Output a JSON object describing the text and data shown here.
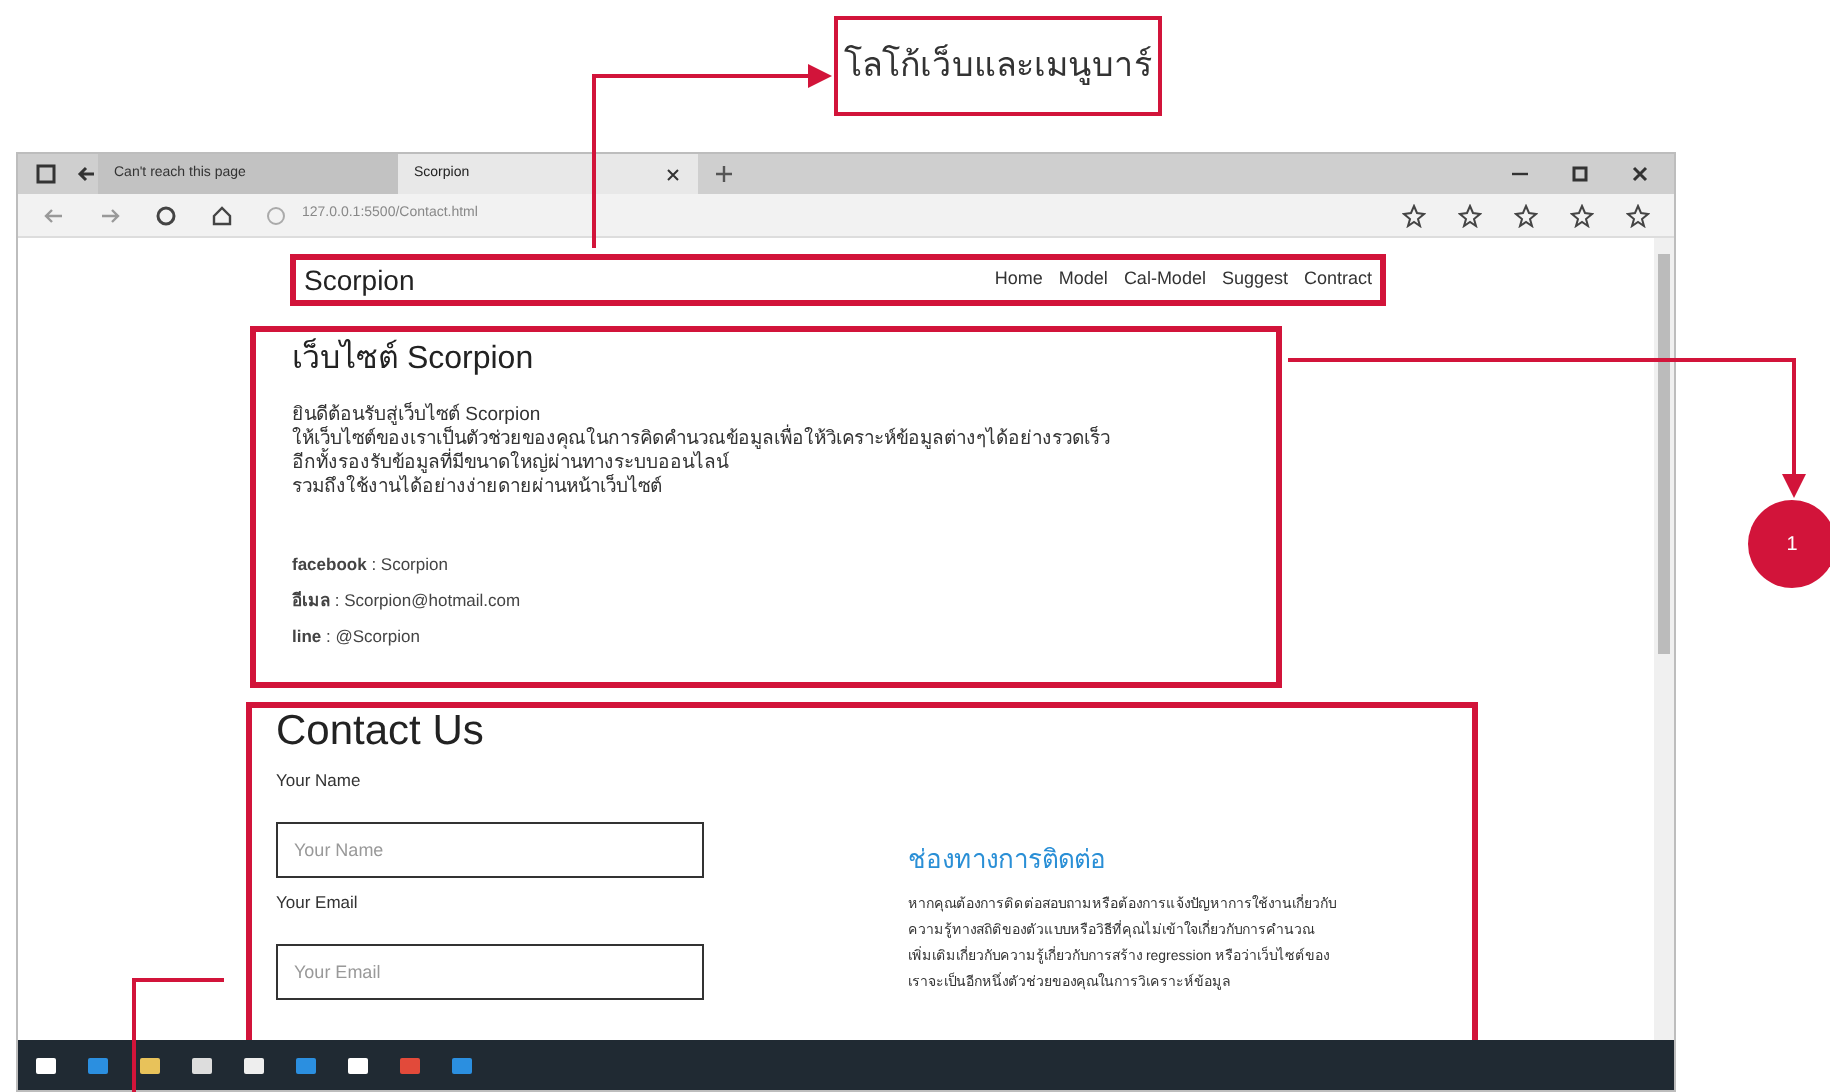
{
  "callout": {
    "text": "โลโก้เว็บและเมนูบาร์"
  },
  "marker": {
    "text": "1"
  },
  "browser": {
    "tabs": [
      {
        "label": "Can't reach this page",
        "selected": false
      },
      {
        "label": "Scorpion",
        "selected": true
      }
    ],
    "address": "127.0.0.1:5500/Contact.html"
  },
  "navbar": {
    "brand": "Scorpion",
    "links": [
      "Home",
      "Model",
      "Cal-Model",
      "Suggest",
      "Contract"
    ]
  },
  "intro": {
    "title": "เว็บไซต์ Scorpion",
    "lines": [
      "ยินดีต้อนรับสู่เว็บไซต์ Scorpion",
      "ให้เว็บไซต์ของเราเป็นตัวช่วยของคุณในการคิดคำนวณข้อมูลเพื่อให้วิเคราะห์ข้อมูลต่างๆได้อย่างรวดเร็ว",
      "อีกทั้งรองรับข้อมูลที่มีขนาดใหญ่ผ่านทางระบบออนไลน์",
      "รวมถึงใช้งานได้อย่างง่ายดายผ่านหน้าเว็บไซต์"
    ],
    "contacts": [
      "**facebook** : Scorpion",
      "**อีเมล** : Scorpion@hotmail.com",
      "**line** : @Scorpion"
    ]
  },
  "contact_form": {
    "title": "Contact Us",
    "fields": [
      {
        "label": "Your Name",
        "placeholder": "Your Name"
      },
      {
        "label": "Your Email",
        "placeholder": "Your Email"
      }
    ]
  },
  "channels": {
    "title": "ช่องทางการติดต่อ",
    "lines": [
      "หากคุณต้องการติดต่อสอบถามหรือต้องการแจ้งปัญหาการใช้งานเกี่ยวกับ",
      "ความรู้ทางสถิติของตัวแบบหรือวิธีที่คุณไม่เข้าใจเกี่ยวกับการคำนวณ",
      "เพิ่มเติมเกี่ยวกับความรู้เกี่ยวกับการสร้าง regression หรือว่าเว็บไซต์ของ",
      "เราจะเป็นอีกหนึ่งตัวช่วยของคุณในการวิเคราะห์ข้อมูล"
    ]
  }
}
